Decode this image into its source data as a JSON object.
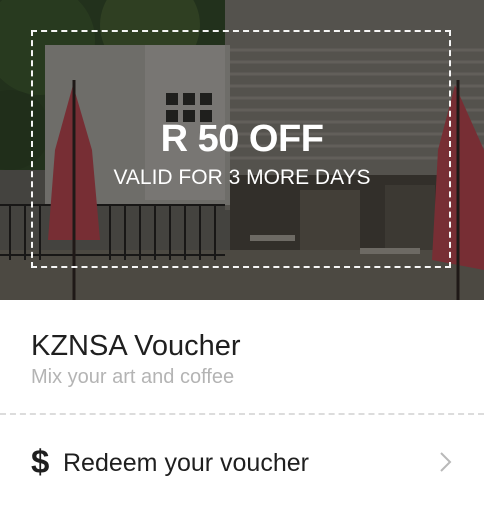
{
  "voucher": {
    "offer_amount": "R 50 OFF",
    "validity": "VALID FOR 3 MORE DAYS",
    "title": "KZNSA Voucher",
    "subtitle": "Mix your art and coffee"
  },
  "redeem": {
    "icon_glyph": "$",
    "label": "Redeem your voucher",
    "chevron_icon": "chevron-right-icon"
  },
  "colors": {
    "overlay": "#000000",
    "umbrella": "#d9545f",
    "title_text": "#1f1f1f",
    "subtitle_text": "#b4b4b4",
    "divider": "#dcdcdc"
  }
}
